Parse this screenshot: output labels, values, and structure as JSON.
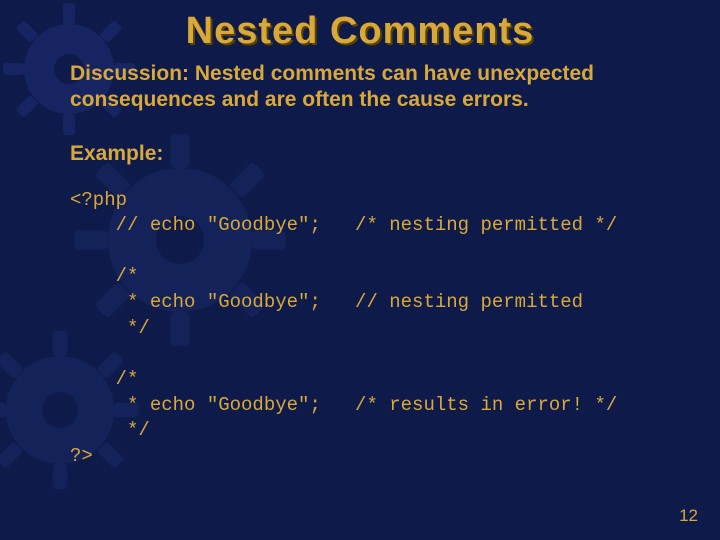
{
  "slide": {
    "title": "Nested Comments",
    "discussion": "Discussion: Nested comments can have unexpected consequences and are often the cause errors.",
    "example_label": "Example:",
    "code": "<?php\n    // echo \"Goodbye\";   /* nesting permitted */\n\n    /*\n     * echo \"Goodbye\";   // nesting permitted\n     */\n\n    /*\n     * echo \"Goodbye\";   /* results in error! */\n     */\n?>",
    "page_number": "12"
  }
}
